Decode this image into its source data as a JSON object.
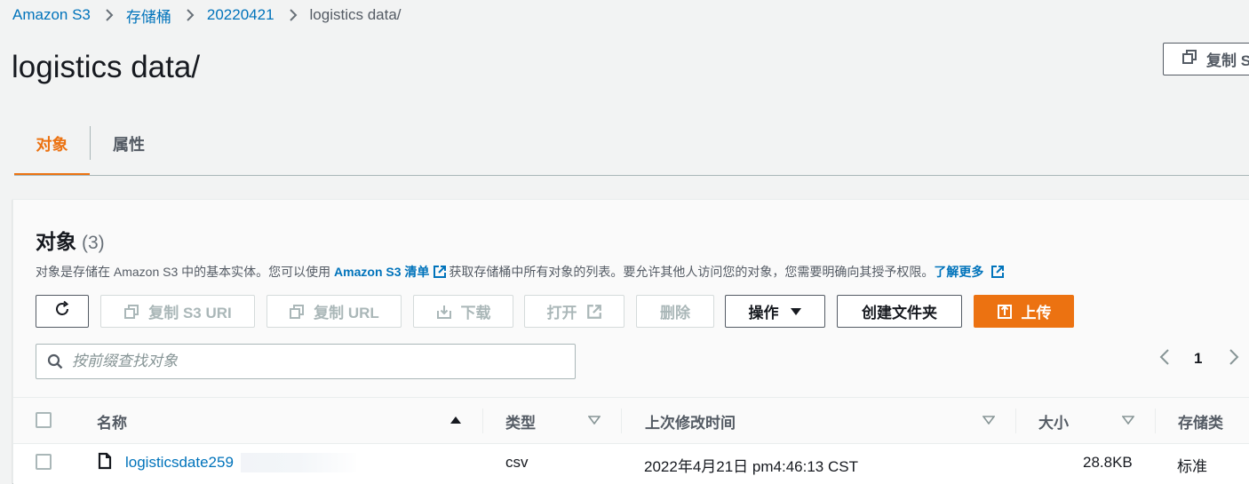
{
  "breadcrumb": {
    "items": [
      "Amazon S3",
      "存储桶",
      "20220421"
    ],
    "current": "logistics data/"
  },
  "page": {
    "title": "logistics data/",
    "copy_s3_uri_short": "复制 S"
  },
  "tabs": [
    {
      "label": "对象",
      "active": true
    },
    {
      "label": "属性",
      "active": false
    }
  ],
  "objects_panel": {
    "title": "对象",
    "count": "(3)",
    "description": {
      "part1": "对象是存储在 Amazon S3 中的基本实体。您可以使用 ",
      "inventory_link": "Amazon S3 清单",
      "part2": "获取存储桶中所有对象的列表。要允许其他人访问您的对象，您需要明确向其授予权限。",
      "learn_more": "了解更多"
    },
    "buttons": {
      "copy_s3_uri": "复制 S3 URI",
      "copy_url": "复制 URL",
      "download": "下载",
      "open": "打开",
      "delete": "删除",
      "actions": "操作",
      "create_folder": "创建文件夹",
      "upload": "上传"
    },
    "search": {
      "placeholder": "按前缀查找对象",
      "value": ""
    },
    "pagination": {
      "current_page": "1"
    },
    "columns": [
      "名称",
      "类型",
      "上次修改时间",
      "大小",
      "存储类"
    ],
    "rows": [
      {
        "name": "logisticsdate259",
        "type": "csv",
        "modified": "2022年4月21日 pm4:46:13 CST",
        "size": "28.8KB",
        "storage_class": "标准"
      }
    ]
  },
  "colors": {
    "accent": "#ec7211",
    "link": "#0073bb",
    "text": "#16191f",
    "muted": "#545b64",
    "background": "#f2f3f3"
  },
  "icons": [
    "chevron-right-icon",
    "copy-icon",
    "refresh-icon",
    "download-icon",
    "external-link-icon",
    "caret-down-icon",
    "upload-icon",
    "search-icon",
    "chevron-left-icon",
    "sort-up-icon",
    "sort-down-icon",
    "file-icon"
  ]
}
